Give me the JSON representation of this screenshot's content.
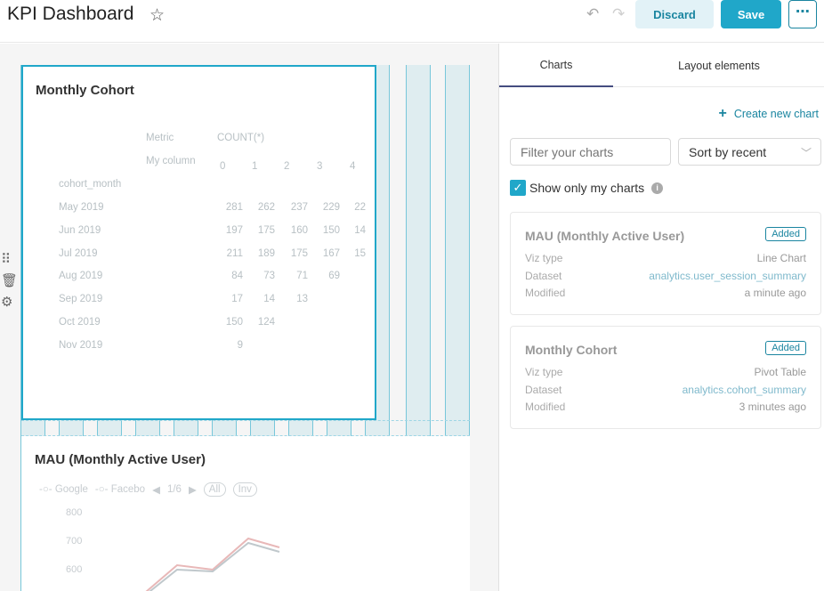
{
  "header": {
    "title": "KPI Dashboard",
    "discard_label": "Discard",
    "save_label": "Save",
    "more_label": "⋯"
  },
  "dashboard": {
    "chart1": {
      "title": "Monthly Cohort",
      "metric_label": "Metric",
      "metric_value": "COUNT(*)",
      "column_label": "My column",
      "row_header": "cohort_month",
      "columns": [
        "0",
        "1",
        "2",
        "3",
        "4"
      ],
      "rows": [
        {
          "label": "May 2019",
          "values": [
            "281",
            "262",
            "237",
            "229",
            "22"
          ]
        },
        {
          "label": "Jun 2019",
          "values": [
            "197",
            "175",
            "160",
            "150",
            "14"
          ]
        },
        {
          "label": "Jul 2019",
          "values": [
            "211",
            "189",
            "175",
            "167",
            "15"
          ]
        },
        {
          "label": "Aug 2019",
          "values": [
            "84",
            "73",
            "71",
            "69",
            ""
          ]
        },
        {
          "label": "Sep 2019",
          "values": [
            "17",
            "14",
            "13",
            "",
            ""
          ]
        },
        {
          "label": "Oct 2019",
          "values": [
            "150",
            "124",
            "",
            "",
            ""
          ]
        },
        {
          "label": "Nov 2019",
          "values": [
            "9",
            "",
            "",
            "",
            ""
          ]
        }
      ]
    },
    "chart2": {
      "title": "MAU (Monthly Active User)",
      "legend": [
        "Google",
        "Facebo",
        "1/6",
        "All",
        "Inv"
      ],
      "y_ticks": [
        "800",
        "700",
        "600"
      ]
    }
  },
  "panel": {
    "tabs": [
      "Charts",
      "Layout elements"
    ],
    "create_label": "Create new chart",
    "filter_placeholder": "Filter your charts",
    "sort_value": "Sort by recent",
    "show_mine_label": "Show only my charts",
    "cards": [
      {
        "title": "MAU (Monthly Active User)",
        "badge": "Added",
        "viz_key": "Viz type",
        "viz": "Line Chart",
        "dataset_key": "Dataset",
        "dataset": "analytics.user_session_summary",
        "modified_key": "Modified",
        "modified": "a minute ago"
      },
      {
        "title": "Monthly Cohort",
        "badge": "Added",
        "viz_key": "Viz type",
        "viz": "Pivot Table",
        "dataset_key": "Dataset",
        "dataset": "analytics.cohort_summary",
        "modified_key": "Modified",
        "modified": "3 minutes ago"
      }
    ]
  },
  "colors": {
    "accent": "#20a7c9",
    "accent_dark": "#1a85a0",
    "tab_underline": "#444c80"
  }
}
